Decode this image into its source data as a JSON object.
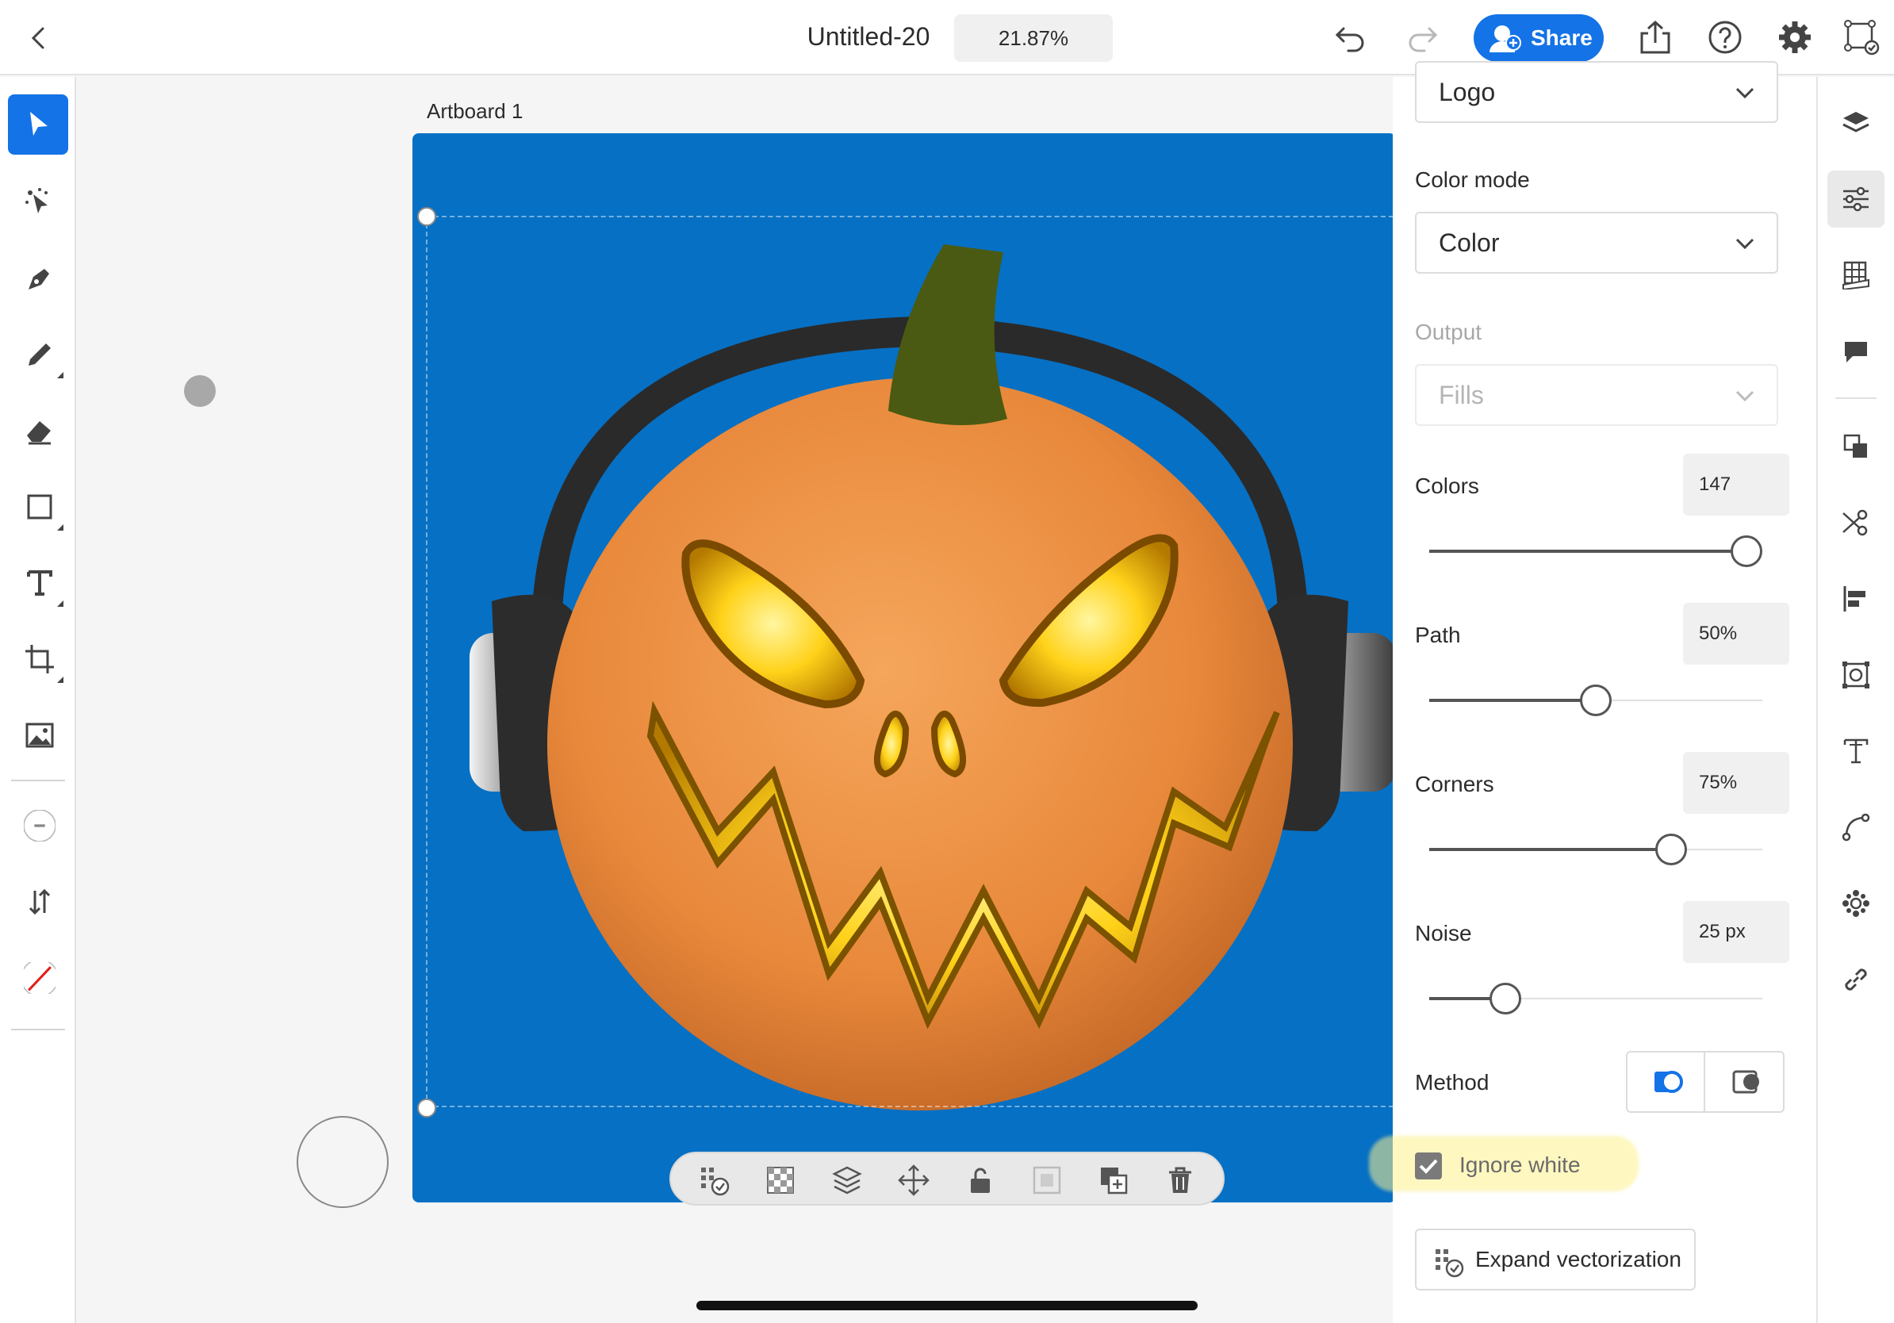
{
  "header": {
    "doc_title": "Untitled-20",
    "zoom": "21.87%",
    "share_label": "Share",
    "brand_color": "#1473e6"
  },
  "left_tools": [
    "select-tool",
    "vectorize-tool",
    "pen-tool",
    "pencil-tool",
    "eraser-tool",
    "shape-tool",
    "text-tool",
    "crop-tool",
    "image-tool",
    "stroke-width",
    "swap-fill-stroke",
    "fill-none"
  ],
  "canvas": {
    "artboard_label": "Artboard 1",
    "artboard_color": "#0670c4"
  },
  "panel": {
    "preset_value": "Logo",
    "color_mode_label": "Color mode",
    "color_mode_value": "Color",
    "output_label": "Output",
    "output_value": "Fills",
    "colors_label": "Colors",
    "colors_value": "147",
    "colors_level": 1.0,
    "path_label": "Path",
    "path_value": "50%",
    "path_level": 0.5,
    "corners_label": "Corners",
    "corners_value": "75%",
    "corners_level": 0.75,
    "noise_label": "Noise",
    "noise_value": "25 px",
    "noise_level": 0.2,
    "method_label": "Method",
    "ignore_white_label": "Ignore white",
    "ignore_white_checked": true,
    "expand_label": "Expand vectorization"
  },
  "right_rail": [
    "layers-icon",
    "properties-icon",
    "grid-icon",
    "comments-icon",
    "arrange-icon",
    "scissors-icon",
    "align-icon",
    "group-icon",
    "type-icon",
    "path-icon",
    "gear-shape-icon",
    "link-icon"
  ]
}
